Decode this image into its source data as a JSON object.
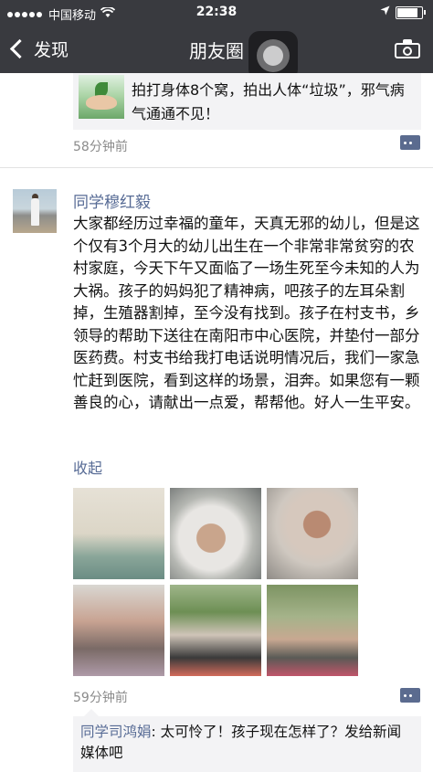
{
  "status_bar": {
    "carrier": "中国移动",
    "time": "22:38"
  },
  "nav": {
    "back_label": "发现",
    "title": "朋友圈"
  },
  "previous_post": {
    "share_text": "拍打身体8个窝，拍出人体“垃圾”，邪气病气通通不见！",
    "time": "58分钟前"
  },
  "post": {
    "author": "同学穆红毅",
    "body": "大家都经历过幸福的童年，天真无邪的幼儿，但是这个仅有3个月大的幼儿出生在一个非常非常贫穷的农村家庭，今天下午又面临了一场生死至今未知的人为大祸。孩子的妈妈犯了精神病，吧孩子的左耳朵割掉，生殖器割掉，至今没有找到。孩子在村支书，乡领导的帮助下送往在南阳市中心医院，并垫付一部分医药费。村支书给我打电话说明情况后，我们一家急忙赶到医院，看到这样的场景，泪奔。如果您有一颗善良的心，请献出一点爱，帮帮他。好人一生平安。",
    "collapse_label": "收起",
    "time": "59分钟前"
  },
  "comments": [
    {
      "name": "同学司鸿娟",
      "text": ": 太可怜了！孩子现在怎样了？发给新闻媒体吧"
    }
  ],
  "icons": {
    "back": "chevron-left-icon",
    "camera": "camera-icon",
    "comment": "comment-icon",
    "location": "location-arrow-icon",
    "wifi": "wifi-icon",
    "battery": "battery-icon"
  },
  "colors": {
    "nav_bg": "#393a3f",
    "link": "#576b95",
    "time_gray": "#8b8b8b",
    "card_bg": "#f3f3f5"
  }
}
